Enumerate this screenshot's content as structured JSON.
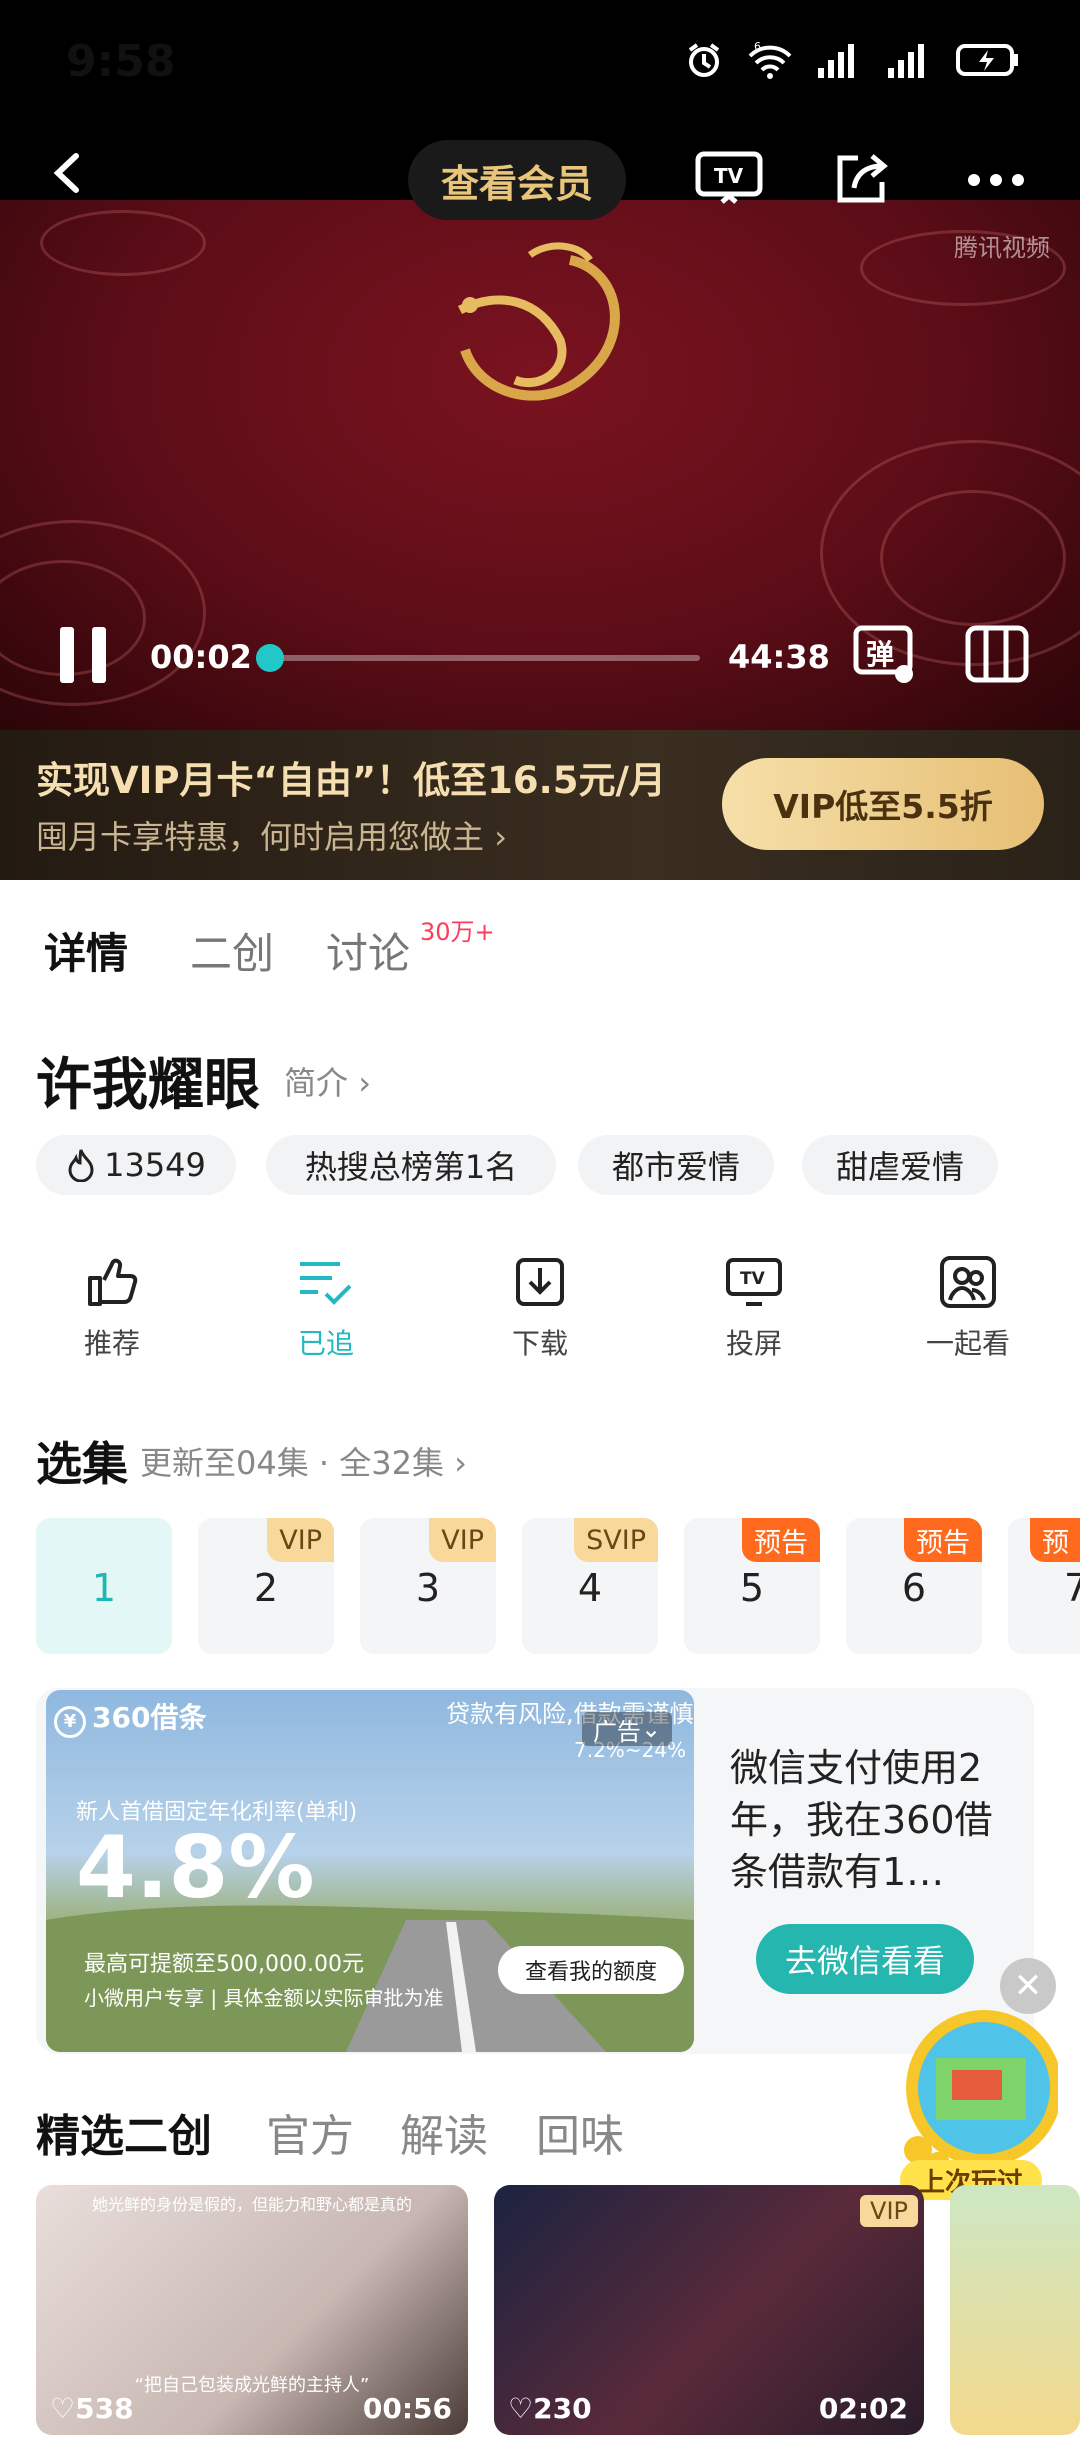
{
  "status_bar": {
    "time": "9:58"
  },
  "player": {
    "membership_button": "查看会员",
    "watermark": "腾讯视频",
    "current_time": "00:02",
    "duration": "44:38",
    "progress": 0.001,
    "danmaku_label": "弹"
  },
  "promo": {
    "title": "实现VIP月卡“自由”！低至16.5元/月",
    "subtitle": "囤月卡享特惠，何时启用您做主",
    "cta": "VIP低至5.5折"
  },
  "tabs": [
    {
      "label": "详情"
    },
    {
      "label": "二创"
    },
    {
      "label": "讨论"
    }
  ],
  "discussion_badge": "30万+",
  "show": {
    "title": "许我耀眼",
    "intro_link": "简介",
    "heat": "13549",
    "tags": [
      "热搜总榜第1名",
      "都市爱情",
      "甜虐爱情"
    ]
  },
  "actions": [
    {
      "label": "推荐",
      "icon": "thumbs-up-icon"
    },
    {
      "label": "已追",
      "icon": "following-list-icon"
    },
    {
      "label": "下载",
      "icon": "download-icon"
    },
    {
      "label": "投屏",
      "icon": "tv-cast-icon"
    },
    {
      "label": "一起看",
      "icon": "watch-together-icon"
    }
  ],
  "episodes": {
    "title": "选集",
    "info": "更新至04集 · 全32集",
    "list": [
      {
        "num": "1",
        "badge": ""
      },
      {
        "num": "2",
        "badge": "VIP"
      },
      {
        "num": "3",
        "badge": "VIP"
      },
      {
        "num": "4",
        "badge": "SVIP"
      },
      {
        "num": "5",
        "badge": "预告"
      },
      {
        "num": "6",
        "badge": "预告"
      },
      {
        "num": "7",
        "badge": "预"
      }
    ]
  },
  "ad": {
    "brand": "360借条",
    "risk_notice": "贷款有风险,借款需谨慎",
    "ad_label": "广告",
    "rate_range": "7.2%~24%",
    "rate_label": "新人首借固定年化利率(单利)",
    "rate": "4.8%",
    "max_amount": "最高可提额至500,000.00元",
    "notice": "小微用户专享 | 具体金额以实际审批为准",
    "quota_button": "查看我的额度",
    "text": "微信支付使用2年，我在360借条借款有1…",
    "cta": "去微信看看"
  },
  "fan_works": {
    "tabs": [
      "精选二创",
      "官方",
      "解读",
      "回味"
    ],
    "items": [
      {
        "likes": "538",
        "duration": "00:56",
        "caption": "她光鲜的身份是假的，但能力和野心都是真的",
        "subtitle": "“把自己包装成光鲜的主持人”"
      },
      {
        "likes": "230",
        "duration": "02:02",
        "badge": "VIP"
      }
    ],
    "floating_label": "上次玩过"
  },
  "colors": {
    "accent_teal": "#22c7c7",
    "vip_gold": "#e6bf74",
    "preview_orange": "#ff6a1f",
    "badge_red": "#ff3b5c"
  }
}
